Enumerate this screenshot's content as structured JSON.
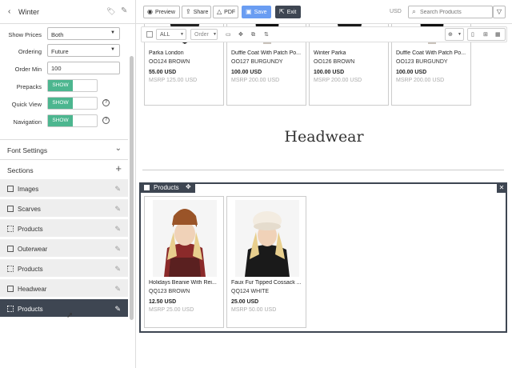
{
  "sidebar": {
    "title": "Winter",
    "fields": [
      {
        "label": "Show Prices",
        "type": "select",
        "value": "Both"
      },
      {
        "label": "Ordering",
        "type": "select",
        "value": "Future"
      },
      {
        "label": "Order Min",
        "type": "input",
        "value": "100"
      },
      {
        "label": "Prepacks",
        "type": "toggle",
        "value": "SHOW"
      },
      {
        "label": "Quick View",
        "type": "toggle",
        "value": "SHOW"
      },
      {
        "label": "Navigation",
        "type": "toggle",
        "value": "SHOW"
      }
    ],
    "font_settings": "Font Settings",
    "sections": "Sections",
    "items": [
      {
        "label": "Images",
        "icon": "image-icon"
      },
      {
        "label": "Scarves",
        "icon": "checkbox-icon"
      },
      {
        "label": "Products",
        "icon": "grid-icon"
      },
      {
        "label": "Outerwear",
        "icon": "checkbox-icon"
      },
      {
        "label": "Products",
        "icon": "grid-icon"
      },
      {
        "label": "Headwear",
        "icon": "checkbox-icon"
      },
      {
        "label": "Products",
        "icon": "grid-icon"
      }
    ]
  },
  "topbar": {
    "preview": "Preview",
    "share": "Share",
    "pdf": "PDF",
    "save": "Save",
    "exit": "Exit",
    "currency": "USD",
    "search_placeholder": "Search Products"
  },
  "toolbar": {
    "all": "ALL",
    "order": "Order"
  },
  "top_products": [
    {
      "name": "Parka London",
      "code": "OO124 BROWN",
      "price": "55.00 USD",
      "msrp": "MSRP 125.00 USD"
    },
    {
      "name": "Duffle Coat With Patch Po...",
      "code": "OO127 BURGUNDY",
      "price": "100.00 USD",
      "msrp": "MSRP 200.00 USD"
    },
    {
      "name": "Winter Parka",
      "code": "OO126 BROWN",
      "price": "100.00 USD",
      "msrp": "MSRP 200.00 USD"
    },
    {
      "name": "Duffle Coat With Patch Po...",
      "code": "OO123 BURGUNDY",
      "price": "100.00 USD",
      "msrp": "MSRP 200.00 USD"
    }
  ],
  "section_heading": "Headwear",
  "selected_block": {
    "label": "Products",
    "products": [
      {
        "name": "Holidays Beanie With Rei...",
        "code": "QQ123 BROWN",
        "price": "12.50 USD",
        "msrp": "MSRP 25.00 USD"
      },
      {
        "name": "Faux Fur Tipped Cossack ...",
        "code": "QQ124 WHITE",
        "price": "25.00 USD",
        "msrp": "MSRP 50.00 USD"
      }
    ]
  },
  "colors": {
    "accent_green": "#4cb68f",
    "save_blue": "#6a9df2",
    "dark": "#3e4652"
  }
}
